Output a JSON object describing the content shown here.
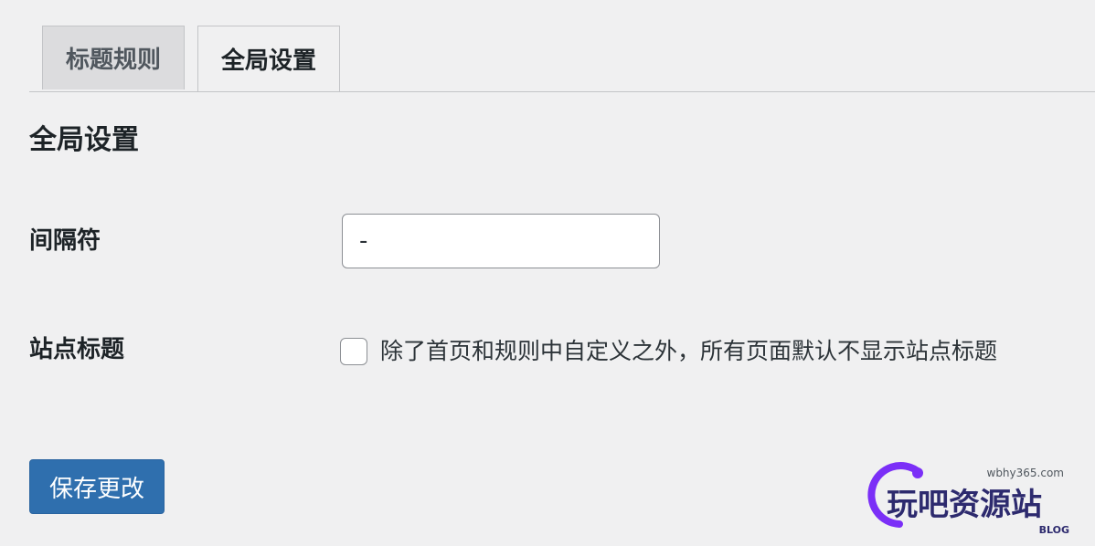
{
  "tabs": [
    {
      "label": "标题规则",
      "active": false
    },
    {
      "label": "全局设置",
      "active": true
    }
  ],
  "section_title": "全局设置",
  "fields": {
    "separator": {
      "label": "间隔符",
      "value": "-"
    },
    "site_title": {
      "label": "站点标题",
      "checkbox_label": "除了首页和规则中自定义之外，所有页面默认不显示站点标题",
      "checked": false
    }
  },
  "save_button": {
    "label": "保存更改"
  },
  "watermark": {
    "domain": "wbhy365.com",
    "name": "玩吧资源站",
    "sub": "BLOG",
    "brand_color": "#7b2ff7"
  },
  "colors": {
    "primary_button": "#2f6fae",
    "background": "#f0f0f1"
  }
}
